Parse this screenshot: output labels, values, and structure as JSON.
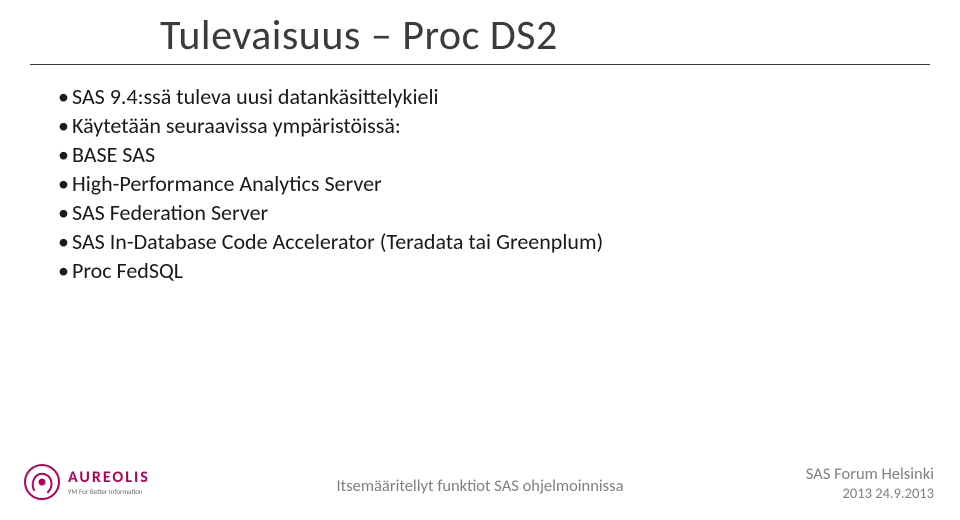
{
  "title": "Tulevaisuus – Proc DS2",
  "bullets": [
    {
      "level": 1,
      "text": "SAS 9.4:ssä tuleva uusi datankäsittelykieli"
    },
    {
      "level": 1,
      "text": "Käytetään seuraavissa ympäristöissä:"
    },
    {
      "level": 2,
      "text": "BASE SAS"
    },
    {
      "level": 2,
      "text": "High-Performance Analytics Server"
    },
    {
      "level": 2,
      "text": "SAS Federation Server"
    },
    {
      "level": 2,
      "text": "SAS In-Database Code Accelerator (Teradata tai Greenplum)"
    },
    {
      "level": 2,
      "text": "Proc FedSQL"
    }
  ],
  "logo": {
    "name": "AUREOLIS",
    "tagline": "YM For Better Information",
    "color": "#b30059"
  },
  "footer": {
    "center": "Itsemääritellyt funktiot SAS ohjelmoinnissa",
    "right_line1": "SAS Forum Helsinki",
    "right_line2": "2013  24.9.2013"
  }
}
